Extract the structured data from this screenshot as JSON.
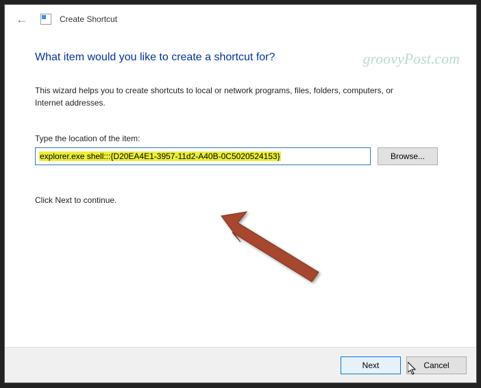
{
  "titlebar": {
    "title": "Create Shortcut"
  },
  "content": {
    "heading": "What item would you like to create a shortcut for?",
    "description": "This wizard helps you to create shortcuts to local or network programs, files, folders, computers, or Internet addresses.",
    "location_label": "Type the location of the item:",
    "location_value": "explorer.exe shell:::{D20EA4E1-3957-11d2-A40B-0C5020524153}",
    "browse_label": "Browse...",
    "continue_text": "Click Next to continue."
  },
  "footer": {
    "next_label": "Next",
    "cancel_label": "Cancel"
  },
  "watermark": "groovyPost.com"
}
